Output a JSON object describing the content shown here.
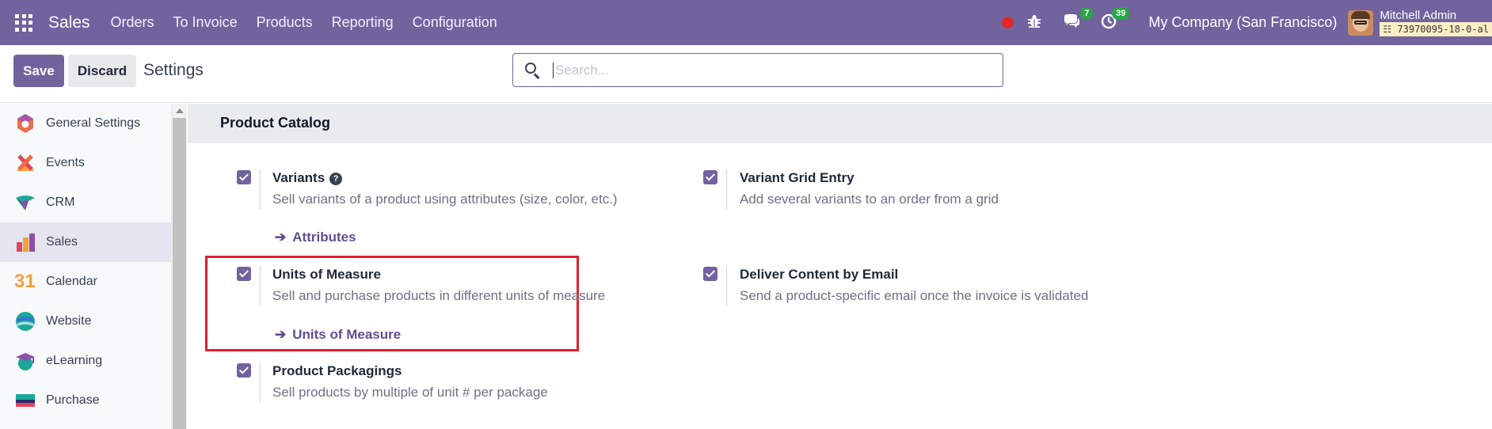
{
  "navbar": {
    "brand": "Sales",
    "menu": [
      "Orders",
      "To Invoice",
      "Products",
      "Reporting",
      "Configuration"
    ],
    "messages_count": "7",
    "activities_count": "39",
    "company": "My Company (San Francisco)",
    "user_name": "Mitchell Admin",
    "db_name": "73970095-18-0-al"
  },
  "control_panel": {
    "save_label": "Save",
    "discard_label": "Discard",
    "title": "Settings",
    "search_placeholder": "Search..."
  },
  "sidebar": {
    "items": [
      {
        "label": "General Settings",
        "icon": "settings-app-icon",
        "active": false
      },
      {
        "label": "Events",
        "icon": "events-app-icon",
        "active": false
      },
      {
        "label": "CRM",
        "icon": "crm-app-icon",
        "active": false
      },
      {
        "label": "Sales",
        "icon": "sales-app-icon",
        "active": true
      },
      {
        "label": "Calendar",
        "icon": "calendar-app-icon",
        "active": false
      },
      {
        "label": "Website",
        "icon": "website-app-icon",
        "active": false
      },
      {
        "label": "eLearning",
        "icon": "elearning-app-icon",
        "active": false
      },
      {
        "label": "Purchase",
        "icon": "purchase-app-icon",
        "active": false
      }
    ],
    "calendar_glyph": "31"
  },
  "section": {
    "title": "Product Catalog",
    "settings": [
      {
        "title": "Variants",
        "description": "Sell variants of a product using attributes (size, color, etc.)",
        "link": "Attributes",
        "checked": true,
        "help": "?"
      },
      {
        "title": "Variant Grid Entry",
        "description": "Add several variants to an order from a grid",
        "checked": true
      },
      {
        "title": "Units of Measure",
        "description": "Sell and purchase products in different units of measure",
        "link": "Units of Measure",
        "checked": true
      },
      {
        "title": "Deliver Content by Email",
        "description": "Send a product-specific email once the invoice is validated",
        "checked": true
      },
      {
        "title": "Product Packagings",
        "description": "Sell products by multiple of unit # per package",
        "checked": true
      }
    ]
  },
  "colors": {
    "brand": "#71639e",
    "highlight": "#e0202c",
    "badge": "#28a745"
  }
}
